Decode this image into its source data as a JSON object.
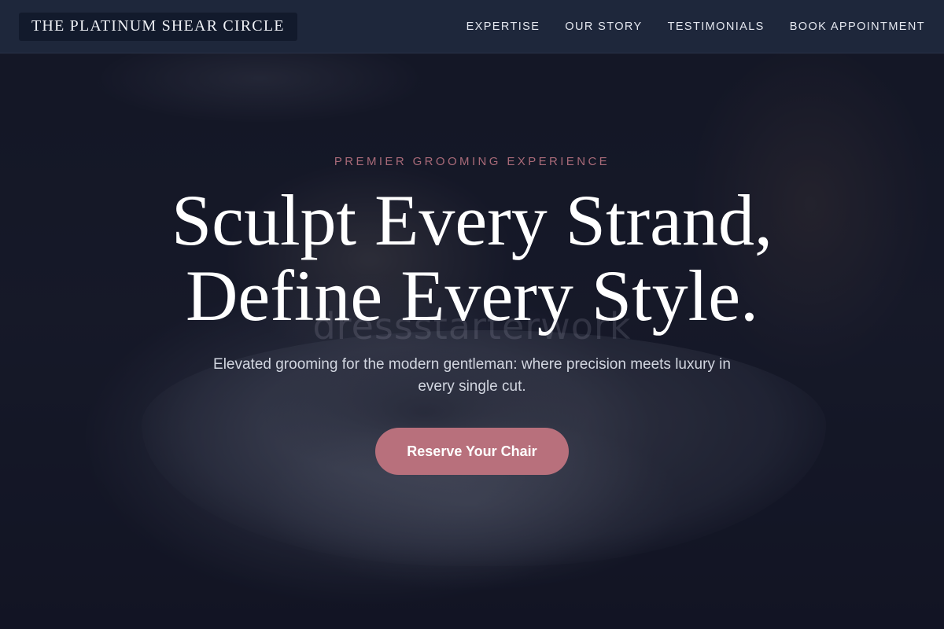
{
  "nav": {
    "brand": "THE PLATINUM SHEAR CIRCLE",
    "links": [
      {
        "label": "EXPERTISE"
      },
      {
        "label": "OUR STORY"
      },
      {
        "label": "TESTIMONIALS"
      },
      {
        "label": "BOOK APPOINTMENT"
      }
    ]
  },
  "hero": {
    "eyebrow": "PREMIER GROOMING EXPERIENCE",
    "headline_line1": "Sculpt Every Strand,",
    "headline_line2": "Define Every Style.",
    "watermark": "dressstarterwork",
    "subtext": "Elevated grooming for the modern gentleman: where precision meets luxury in every single cut.",
    "cta_label": "Reserve Your Chair"
  },
  "colors": {
    "nav_bg": "#1e273b",
    "brand_bg": "#121a2c",
    "accent": "#b8707c",
    "eyebrow": "#a86a78"
  }
}
